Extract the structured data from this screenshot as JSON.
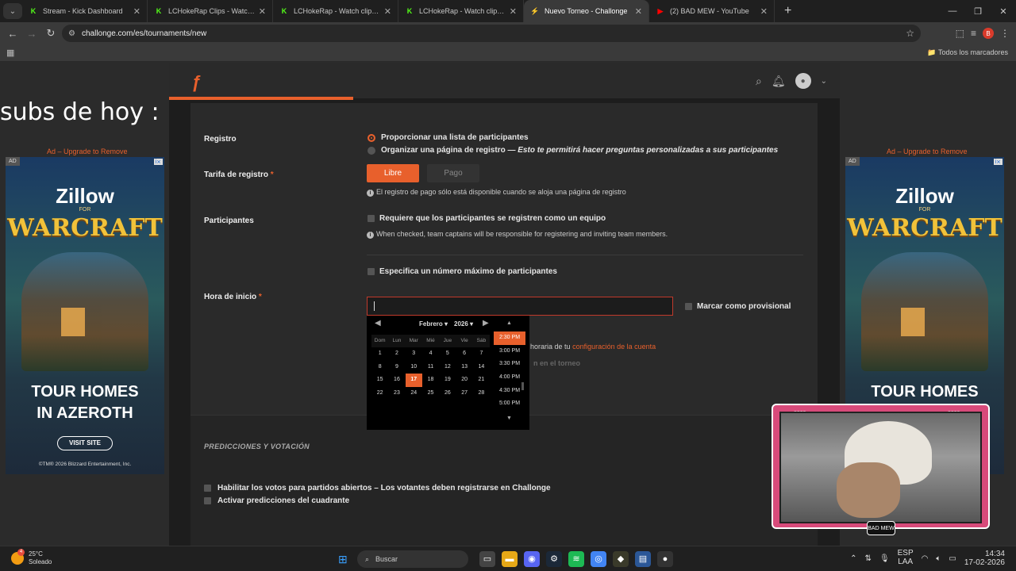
{
  "browser": {
    "tabs": [
      {
        "title": "Stream - Kick Dashboard",
        "fav": "K",
        "color": "#53fc18"
      },
      {
        "title": "LCHokeRap Clips - Watch Live c",
        "fav": "K",
        "color": "#53fc18"
      },
      {
        "title": "LCHokeRap - Watch clips on Kic",
        "fav": "K",
        "color": "#53fc18"
      },
      {
        "title": "LCHokeRap - Watch clips on Kic",
        "fav": "K",
        "color": "#53fc18"
      },
      {
        "title": "Nuevo Torneo - Challonge",
        "fav": "⚡",
        "color": "#e8602c"
      },
      {
        "title": "(2) BAD MEW - YouTube",
        "fav": "▶",
        "color": "#ff0000"
      }
    ],
    "url": "challonge.com/es/tournaments/new",
    "bookmarks_right": "Todos los marcadores",
    "profile_initial": "B"
  },
  "overlay": {
    "subs_text": "subs de hoy :",
    "ad_label": "Ad – Upgrade to Remove",
    "ad": {
      "badge": "AD",
      "brand": "Zillow",
      "for": "FOR",
      "game": "WARCRAFT",
      "headline_1": "TOUR HOMES",
      "headline_2": "IN AZEROTH",
      "cta": "VISIT SITE",
      "copyright": "©TM® 2026 Blizzard Entertainment, Inc."
    }
  },
  "form": {
    "registro_label": "Registro",
    "registro_opt1": "Proporcionar una lista de participantes",
    "registro_opt2": "Organizar una página de registro —",
    "registro_opt2_italic": "Esto te permitirá hacer preguntas personalizadas a sus participantes",
    "tarifa_label": "Tarifa de registro",
    "required": "*",
    "libre": "Libre",
    "pago": "Pago",
    "tarifa_hint": "El registro de pago sólo está disponible cuando se aloja una página de registro",
    "participantes_label": "Participantes",
    "team_check": "Requiere que los participantes se registren como un equipo",
    "team_hint": "When checked, team captains will be responsible for registering and inviting team members.",
    "max_check": "Especifica un número máximo de participantes",
    "hora_label": "Hora de inicio",
    "provisional": "Marcar como provisional",
    "tz_text": "horaria de tu",
    "tz_link": "configuración de la cuenta",
    "torneo_text": "n en el torneo",
    "pred_title": "PREDICCIONES Y VOTACIÓN",
    "votes_check": "Habilitar los votos para partidos abiertos – Los votantes deben registrarse en Challonge",
    "pred_check": "Activar predicciones del cuadrante"
  },
  "calendar": {
    "month": "Febrero",
    "year": "2026",
    "dow": [
      "Dom",
      "Lun",
      "Mar",
      "Mié",
      "Jue",
      "Vie",
      "Sáb"
    ],
    "weeks": [
      [
        "1",
        "2",
        "3",
        "4",
        "5",
        "6",
        "7"
      ],
      [
        "8",
        "9",
        "10",
        "11",
        "12",
        "13",
        "14"
      ],
      [
        "15",
        "16",
        "17",
        "18",
        "19",
        "20",
        "21"
      ],
      [
        "22",
        "23",
        "24",
        "25",
        "26",
        "27",
        "28"
      ]
    ],
    "today": "17",
    "times": [
      "2:30 PM",
      "3:00 PM",
      "3:30 PM",
      "4:00 PM",
      "4:30 PM",
      "5:00 PM"
    ],
    "selected_time": "2:30 PM"
  },
  "taskbar": {
    "temp": "25°C",
    "weather": "Soleado",
    "weather_badge": "4",
    "search": "Buscar",
    "lang_1": "ESP",
    "lang_2": "LAA",
    "time": "14:34",
    "date": "17-02-2026"
  },
  "colors": {
    "accent": "#e8602c",
    "error_border": "#c0392b"
  }
}
